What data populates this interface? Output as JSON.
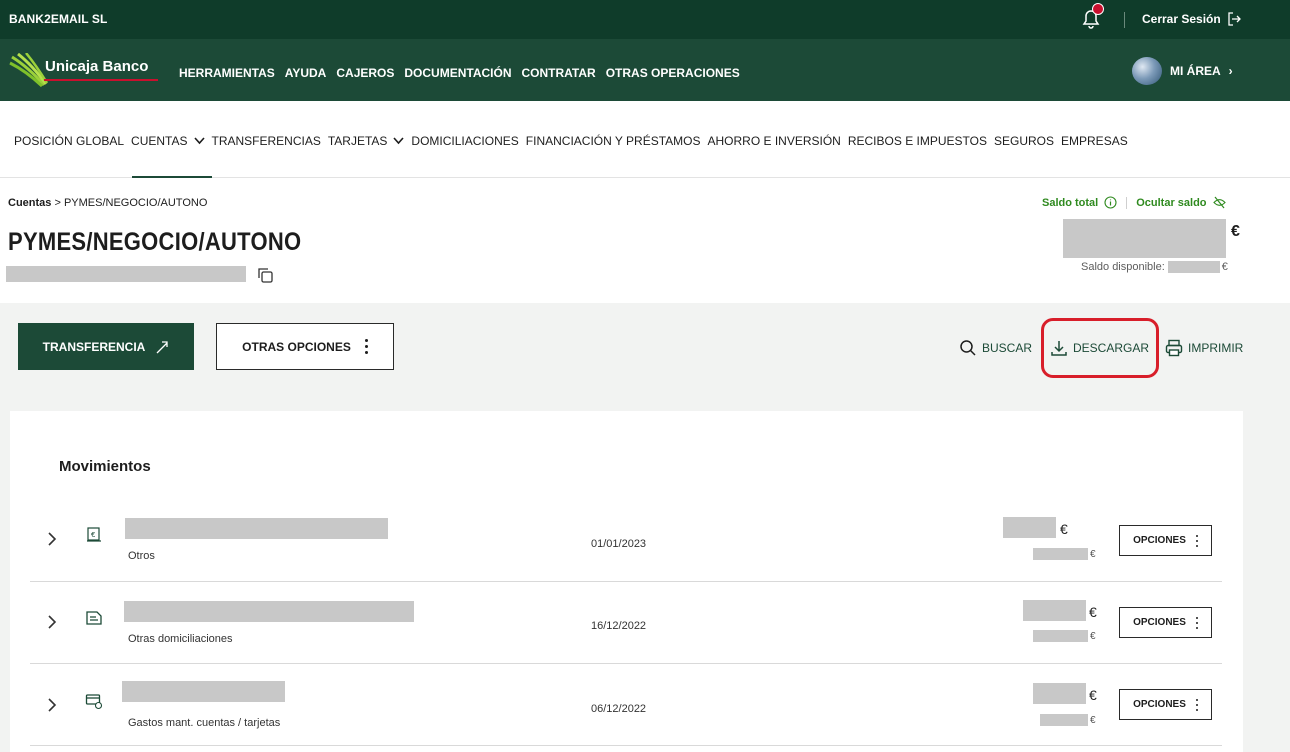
{
  "topbar": {
    "company": "BANK2EMAIL SL",
    "logout_label": "Cerrar Sesión"
  },
  "brand": {
    "logo_name": "Unicaja",
    "logo_suffix": " Banco"
  },
  "main_nav": [
    "HERRAMIENTAS",
    "AYUDA",
    "CAJEROS",
    "DOCUMENTACIÓN",
    "CONTRATAR",
    "OTRAS OPERACIONES"
  ],
  "mi_area_label": "MI ÁREA",
  "sub_nav": [
    {
      "label": "POSICIÓN GLOBAL",
      "dropdown": false
    },
    {
      "label": "CUENTAS",
      "dropdown": true
    },
    {
      "label": "TRANSFERENCIAS",
      "dropdown": false
    },
    {
      "label": "TARJETAS",
      "dropdown": true
    },
    {
      "label": "DOMICILIACIONES",
      "dropdown": false
    },
    {
      "label": "FINANCIACIÓN Y PRÉSTAMOS",
      "dropdown": false
    },
    {
      "label": "AHORRO E INVERSIÓN",
      "dropdown": false
    },
    {
      "label": "RECIBOS E IMPUESTOS",
      "dropdown": false
    },
    {
      "label": "SEGUROS",
      "dropdown": false
    },
    {
      "label": "EMPRESAS",
      "dropdown": false
    }
  ],
  "account": {
    "breadcrumb_root": "Cuentas",
    "breadcrumb_sep": " > ",
    "breadcrumb_current": "PYMES/NEGOCIO/AUTONO",
    "title": "PYMES/NEGOCIO/AUTONO",
    "saldo_total_label": "Saldo total",
    "ocultar_saldo_label": "Ocultar saldo",
    "currency": "€",
    "saldo_disponible_label": "Saldo disponible:"
  },
  "actions": {
    "transferencia_label": "TRANSFERENCIA",
    "otras_opciones_label": "OTRAS OPCIONES",
    "buscar_label": "BUSCAR",
    "descargar_label": "DESCARGAR",
    "imprimir_label": "IMPRIMIR"
  },
  "movimientos": {
    "title": "Movimientos",
    "options_label": "OPCIONES",
    "rows": [
      {
        "category": "Otros",
        "date": "01/01/2023",
        "icon": "cash-icon",
        "currency": "€"
      },
      {
        "category": "Otras domiciliaciones",
        "date": "16/12/2022",
        "icon": "receipt-icon",
        "currency": "€"
      },
      {
        "category": "Gastos mant. cuentas / tarjetas",
        "date": "06/12/2022",
        "icon": "card-fee-icon",
        "currency": "€"
      }
    ]
  },
  "colors": {
    "topbar": "#0f3c2a",
    "brandbar": "#1c4a37",
    "accent_green": "#2f8a1f",
    "highlight_red": "#d81e2a"
  }
}
